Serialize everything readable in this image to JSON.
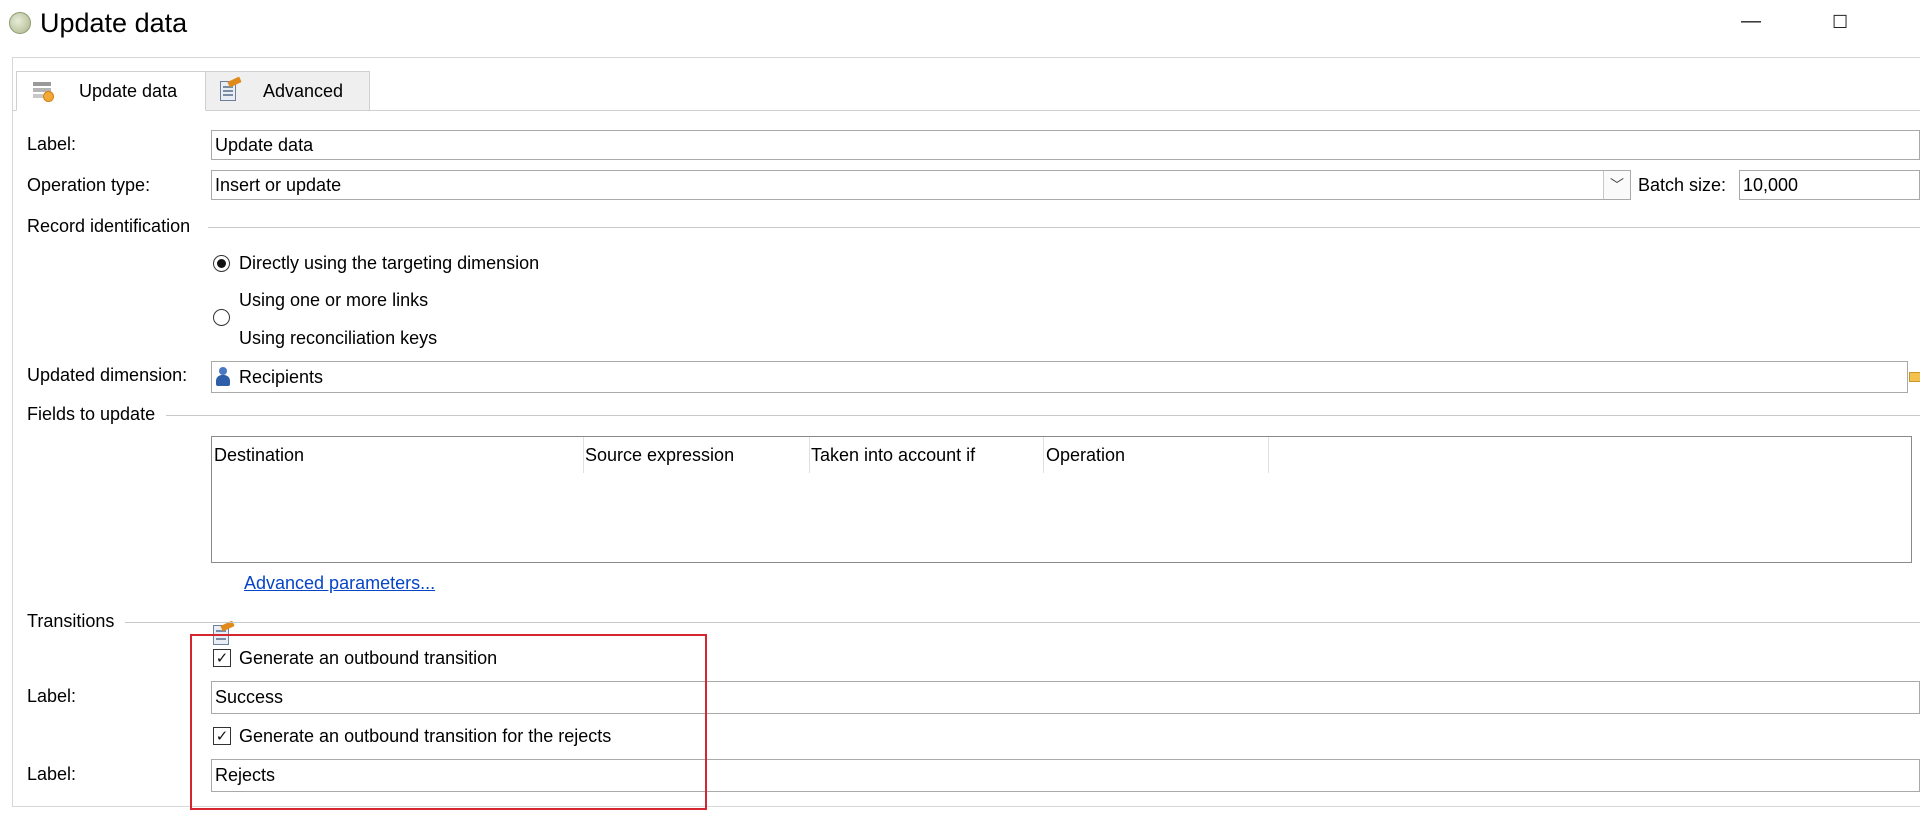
{
  "window": {
    "title": "Update data",
    "minimize_glyph": "—",
    "maximize_glyph": "☐"
  },
  "tabs": [
    {
      "label": "Update data",
      "icon": "update-data-icon",
      "active": true
    },
    {
      "label": "Advanced",
      "icon": "advanced-icon",
      "active": false
    }
  ],
  "form": {
    "label_caption": "Label:",
    "label_value": "Update data",
    "operation_type_caption": "Operation type:",
    "operation_type_value": "Insert or update",
    "batch_size_caption": "Batch size:",
    "batch_size_value": "10,000"
  },
  "record_identification": {
    "title": "Record identification",
    "options": [
      {
        "label": "Directly using the targeting dimension",
        "selected": true
      },
      {
        "label": "Using one or more links",
        "selected": false
      },
      {
        "label": "Using reconciliation keys",
        "selected": false
      }
    ]
  },
  "updated_dimension": {
    "caption": "Updated dimension:",
    "value": "Recipients",
    "icon": "recipient-person-icon"
  },
  "fields_to_update": {
    "title": "Fields to update",
    "columns": [
      "Destination",
      "Source expression",
      "Taken into account if",
      "Operation"
    ],
    "rows": [],
    "advanced_link": "Advanced parameters..."
  },
  "transitions": {
    "title": "Transitions",
    "outbound_checkbox_label": "Generate an outbound transition",
    "outbound_checked": true,
    "outbound_label_caption": "Label:",
    "outbound_label_value": "Success",
    "rejects_checkbox_label": "Generate an outbound transition for the rejects",
    "rejects_checked": true,
    "rejects_label_caption": "Label:",
    "rejects_label_value": "Rejects"
  },
  "colors": {
    "highlight_border": "#d4262f",
    "link": "#0645c8"
  }
}
